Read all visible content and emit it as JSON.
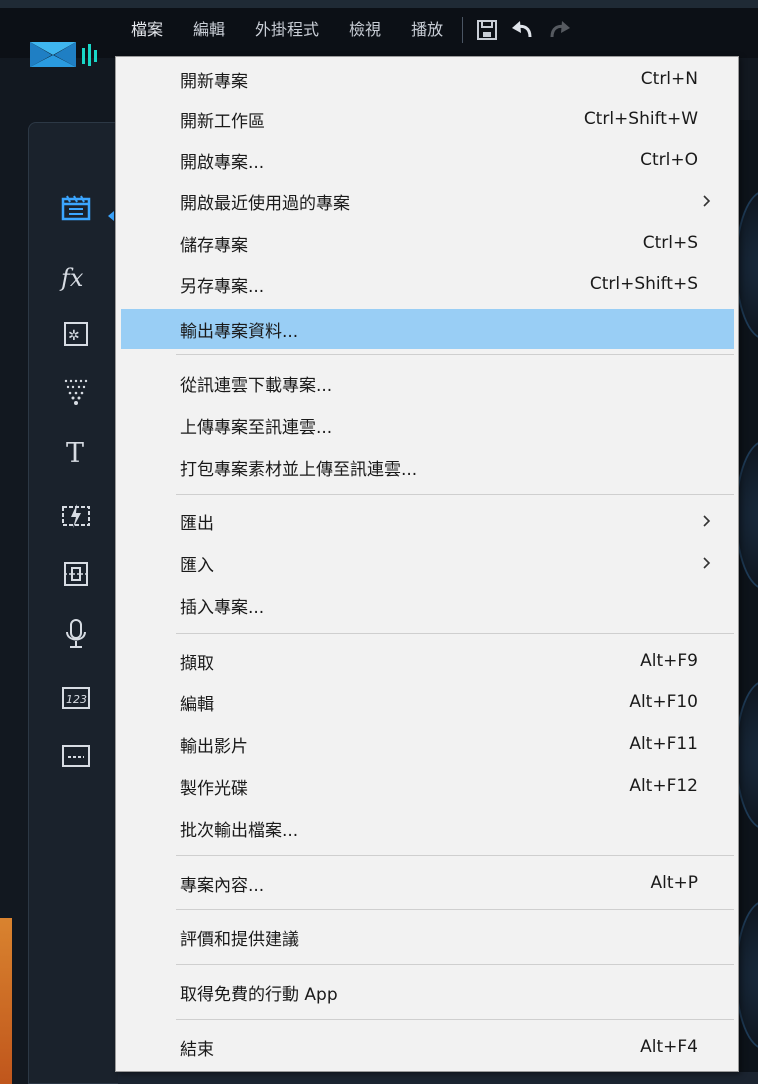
{
  "menubar": {
    "items": [
      "檔案",
      "編輯",
      "外掛程式",
      "檢視",
      "播放"
    ]
  },
  "toolbar": {
    "icons": [
      "save-icon",
      "undo-icon",
      "redo-icon"
    ]
  },
  "left_toolbar": {
    "icons": [
      "media-room-icon",
      "fx-icon",
      "pip-objects-icon",
      "particle-icon",
      "title-icon",
      "transition-icon",
      "audio-mix-icon",
      "voice-over-icon",
      "chapter-icon",
      "subtitle-icon"
    ]
  },
  "file_menu": {
    "items": [
      {
        "label": "開新專案",
        "shortcut": "Ctrl+N"
      },
      {
        "label": "開新工作區",
        "shortcut": "Ctrl+Shift+W"
      },
      {
        "label": "開啟專案...",
        "shortcut": "Ctrl+O"
      },
      {
        "label": "開啟最近使用過的專案",
        "shortcut": "",
        "submenu": true
      },
      {
        "label": "儲存專案",
        "shortcut": "Ctrl+S"
      },
      {
        "label": "另存專案...",
        "shortcut": "Ctrl+Shift+S"
      },
      {
        "label": "輸出專案資料...",
        "shortcut": "",
        "highlighted": true
      },
      {
        "label": "從訊連雲下載專案...",
        "shortcut": ""
      },
      {
        "label": "上傳專案至訊連雲...",
        "shortcut": ""
      },
      {
        "label": "打包專案素材並上傳至訊連雲...",
        "shortcut": ""
      },
      {
        "label": "匯出",
        "shortcut": "",
        "submenu": true
      },
      {
        "label": "匯入",
        "shortcut": "",
        "submenu": true
      },
      {
        "label": "插入專案...",
        "shortcut": ""
      },
      {
        "label": "擷取",
        "shortcut": "Alt+F9"
      },
      {
        "label": "編輯",
        "shortcut": "Alt+F10"
      },
      {
        "label": "輸出影片",
        "shortcut": "Alt+F11"
      },
      {
        "label": "製作光碟",
        "shortcut": "Alt+F12"
      },
      {
        "label": "批次輸出檔案...",
        "shortcut": ""
      },
      {
        "label": "專案內容...",
        "shortcut": "Alt+P"
      },
      {
        "label": "評價和提供建議",
        "shortcut": ""
      },
      {
        "label": "取得免費的行動 App",
        "shortcut": ""
      },
      {
        "label": "結束",
        "shortcut": "Alt+F4"
      }
    ]
  },
  "colors": {
    "highlight": "#99cef5",
    "menu_bg": "#f2f2f2",
    "app_bg": "#121820",
    "accent": "#3ba6ff"
  }
}
